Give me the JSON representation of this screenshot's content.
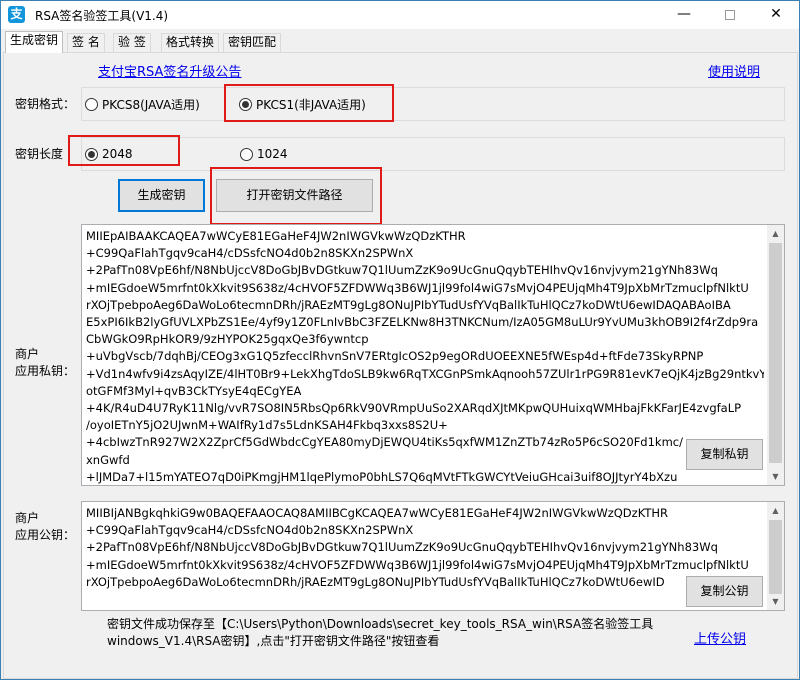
{
  "window": {
    "title": "RSA签名验签工具(V1.4)",
    "icon_name": "alipay-icon",
    "controls": {
      "minimize": "—",
      "maximize": "",
      "close": "✕"
    }
  },
  "tabs": [
    {
      "label": "生成密钥",
      "active": true
    },
    {
      "label": "签 名",
      "active": false
    },
    {
      "label": "验 签",
      "active": false
    },
    {
      "label": "格式转换",
      "active": false
    },
    {
      "label": "密钥匹配",
      "active": false
    }
  ],
  "links": {
    "announcement": "支付宝RSA签名升级公告",
    "help": "使用说明",
    "upload_public_key": "上传公钥"
  },
  "key_format": {
    "label": "密钥格式：",
    "options": [
      {
        "label": "PKCS8(JAVA适用)",
        "checked": false
      },
      {
        "label": "PKCS1(非JAVA适用)",
        "checked": true
      }
    ]
  },
  "key_length": {
    "label": "密钥长度",
    "options": [
      {
        "label": "2048",
        "checked": true
      },
      {
        "label": "1024",
        "checked": false
      }
    ]
  },
  "buttons": {
    "generate": "生成密钥",
    "open_path": "打开密钥文件路径",
    "copy_private": "复制私钥",
    "copy_public": "复制公钥"
  },
  "private_key": {
    "label_line1": "商户",
    "label_line2": "应用私钥：",
    "text": "MIIEpAIBAAKCAQEA7wWCyE81EGaHeF4JW2nIWGVkwWzQDzKTHR\n+C99QaFlahTgqv9caH4/cDSsfcNO4d0b2n8SKXn2SPWnX\n+2PafTn08VpE6hf/N8NbUjccV8DoGbJBvDGtkuw7Q1lUumZzK9o9UcGnuQqybTEHIhvQv16nvjvym21gYNh83Wq\n+mIEGdoeW5mrfnt0kXkvit9S638z/4cHVOF5ZFDWWq3B6WJ1jl99fol4wiG7sMvjO4PEUjqMh4T9JpXbMrTzmuclpfNlktU\nrXOjTpebpoAeg6DaWoLo6tecmnDRh/jRAEzMT9gLg8ONuJPIbYTudUsfYVqBalIkTuHlQCz7koDWtU6ewIDAQABAoIBA\nE5xPI6IkB2lyGfUVLXPbZS1Ee/4yf9y1Z0FLnIvBbC3FZELKNw8H3TNKCNum/IzA05GM8uLUr9YvUMu3khOB9I2f4rZdp9ra\nCbWGkO9RpHkOR9/9zHYPOK25gqxQe3f6ywntcp\n+uVbgVscb/7dqhBj/CEOg3xG1Q5zfecclRhvnSnV7ERtgIcOS2p9egORdUOEEXNE5fWEsp4d+ftFde73SkyRPNP\n+Vd1n4wfv9i4zsAqyIZE/4lHT0Br9+LekXhgTdoSLB9kw6RqTXCGnPSmkAqnooh57ZUlr1rPG9R81evK7eQjK4jzBg29ntkvY\notGFMf3Myl+qvB3CkTYsyE4qECgYEA\n+4K/R4uD4U7RyK11Nlg/vvR7SO8IN5RbsQp6RkV90VRmpUuSo2XARqdXJtMKpwQUHuixqWMHbajFkKFarJE4zvgfaLP\n/oyoIETnY5jO2UJwnM+WAIfRy1d7s5LdnKSAH4Fkbq3xxs8S2U+\n+4cbIwzTnR927W2X2ZprCf5GdWbdcCgYEA80myDjEWQU4tiKs5qxfWM1ZnZTb74zRo5P6cSO20Fd1kmc/\nxnGwfd\n+lJMDa7+l15mYATEO7qD0iPKmgjHM1lqePlymoP0bhLS7Q6qMVtFTkGWCYtVeiuGHcai3uif8OJJtyrY4bXzu"
  },
  "public_key": {
    "label_line1": "商户",
    "label_line2": "应用公钥：",
    "text": "MIIBIjANBgkqhkiG9w0BAQEFAAOCAQ8AMIIBCgKCAQEA7wWCyE81EGaHeF4JW2nIWGVkwWzQDzKTHR\n+C99QaFlahTgqv9caH4/cDSsfcNO4d0b2n8SKXn2SPWnX\n+2PafTn08VpE6hf/N8NbUjccV8DoGbJBvDGtkuw7Q1lUumZzK9o9UcGnuQqybTEHIhvQv16nvjvym21gYNh83Wq\n+mIEGdoeW5mrfnt0kXkvit9S638z/4cHVOF5ZFDWWq3B6WJ1jl99fol4wiG7sMvjO4PEUjqMh4T9JpXbMrTzmuclpfNlktU\nrXOjTpebpoAeg6DaWoLo6tecmnDRh/jRAEzMT9gLg8ONuJPIbYTudUsfYVqBalIkTuHlQCz7koDWtU6ewID"
  },
  "status": {
    "line1": "密钥文件成功保存至【C:\\Users\\Python\\Downloads\\secret_key_tools_RSA_win\\RSA签名验签工具",
    "line2": "windows_V1.4\\RSA密钥】,点击\"打开密钥文件路径\"按钮查看"
  },
  "colors": {
    "highlight_red": "#e01919",
    "link_blue": "#0000ee",
    "focus_blue": "#0078d7",
    "app_icon_blue": "#1296db"
  }
}
